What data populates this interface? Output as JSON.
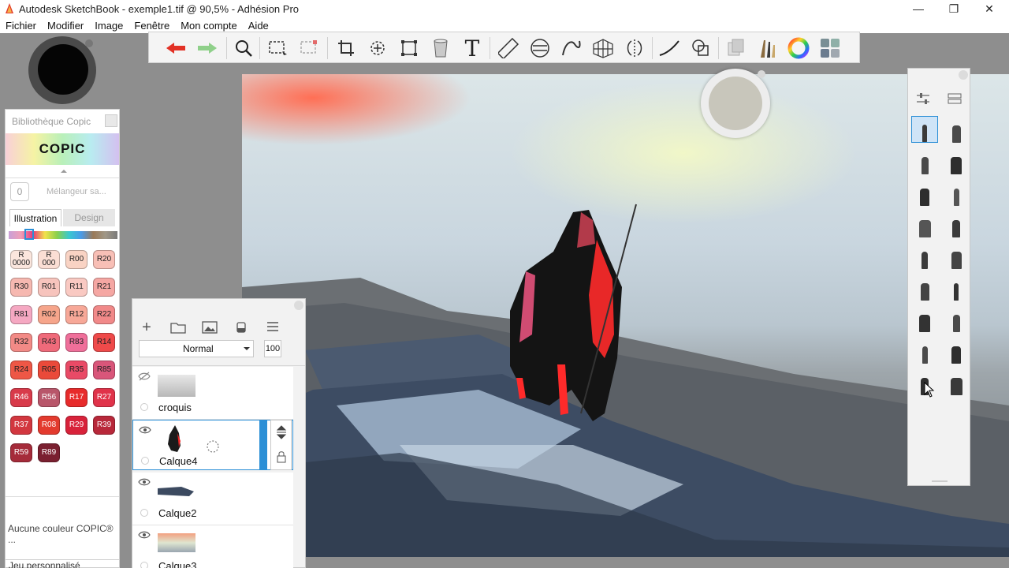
{
  "window": {
    "title": "Autodesk SketchBook - exemple1.tif @ 90,5% - Adhésion Pro",
    "minimize": "—",
    "restore": "❐",
    "close": "✕"
  },
  "menu": [
    "Fichier",
    "Modifier",
    "Image",
    "Fenêtre",
    "Mon compte",
    "Aide"
  ],
  "toolbar": {
    "tools": [
      "undo-icon",
      "redo-icon",
      "zoom-icon",
      "rect-select-icon",
      "select-icon",
      "crop-icon",
      "transform-icon",
      "distort-icon",
      "fill-icon",
      "text-icon",
      "ruler-icon",
      "ellipse-guide-icon",
      "french-curve-icon",
      "perspective-icon",
      "symmetry-icon",
      "stroke-icon",
      "shape-icon",
      "copy-icon",
      "brush-library-icon",
      "color-wheel-icon",
      "copic-palette-icon"
    ],
    "text_tool_glyph": "T"
  },
  "copic": {
    "title": "Bibliothèque Copic",
    "logo": "COPIC",
    "mixer_count": "0",
    "mixer_label": "Mélangeur sa...",
    "tabs": [
      "Illustration",
      "Design"
    ],
    "swatches": [
      {
        "label": "R\n0000",
        "color": "#fbe6dd"
      },
      {
        "label": "R\n000",
        "color": "#fbded4"
      },
      {
        "label": "R00",
        "color": "#f9d3c4"
      },
      {
        "label": "R20",
        "color": "#f8bfb6"
      },
      {
        "label": "R30",
        "color": "#f6b8b0"
      },
      {
        "label": "R01",
        "color": "#f7c4bd"
      },
      {
        "label": "R11",
        "color": "#f9c9c2"
      },
      {
        "label": "R21",
        "color": "#f5a7a3"
      },
      {
        "label": "R81",
        "color": "#f5a8c2"
      },
      {
        "label": "R02",
        "color": "#f6a58b"
      },
      {
        "label": "R12",
        "color": "#f7a898"
      },
      {
        "label": "R22",
        "color": "#f18989"
      },
      {
        "label": "R32",
        "color": "#f28a86"
      },
      {
        "label": "R43",
        "color": "#ef6a7a"
      },
      {
        "label": "R83",
        "color": "#ef6f9a"
      },
      {
        "label": "R14",
        "color": "#ef4a4a"
      },
      {
        "label": "R24",
        "color": "#ee5746"
      },
      {
        "label": "R05",
        "color": "#ea4a3a"
      },
      {
        "label": "R35",
        "color": "#e94a66"
      },
      {
        "label": "R85",
        "color": "#d9567a"
      },
      {
        "label": "R46",
        "color": "#d83a4a"
      },
      {
        "label": "R56",
        "color": "#b8566a"
      },
      {
        "label": "R17",
        "color": "#e72b2b"
      },
      {
        "label": "R27",
        "color": "#e0334a"
      },
      {
        "label": "R37",
        "color": "#d2373f"
      },
      {
        "label": "R08",
        "color": "#e33a2e"
      },
      {
        "label": "R29",
        "color": "#d8223a"
      },
      {
        "label": "R39",
        "color": "#b8283a"
      },
      {
        "label": "R59",
        "color": "#a52b3a"
      },
      {
        "label": "R89",
        "color": "#7a2030"
      }
    ],
    "no_color": "Aucune couleur COPIC® ...",
    "custom_set": "Jeu personnalisé"
  },
  "layers": {
    "blend_mode": "Normal",
    "opacity": "100",
    "items": [
      {
        "name": "croquis",
        "visible": false
      },
      {
        "name": "Calque4",
        "visible": true,
        "selected": true
      },
      {
        "name": "Calque2",
        "visible": true
      },
      {
        "name": "Calque3",
        "visible": true
      }
    ]
  },
  "colors": {
    "current": "#050505",
    "secondary": "#c8c6bb",
    "accent": "#2b8fd6"
  }
}
